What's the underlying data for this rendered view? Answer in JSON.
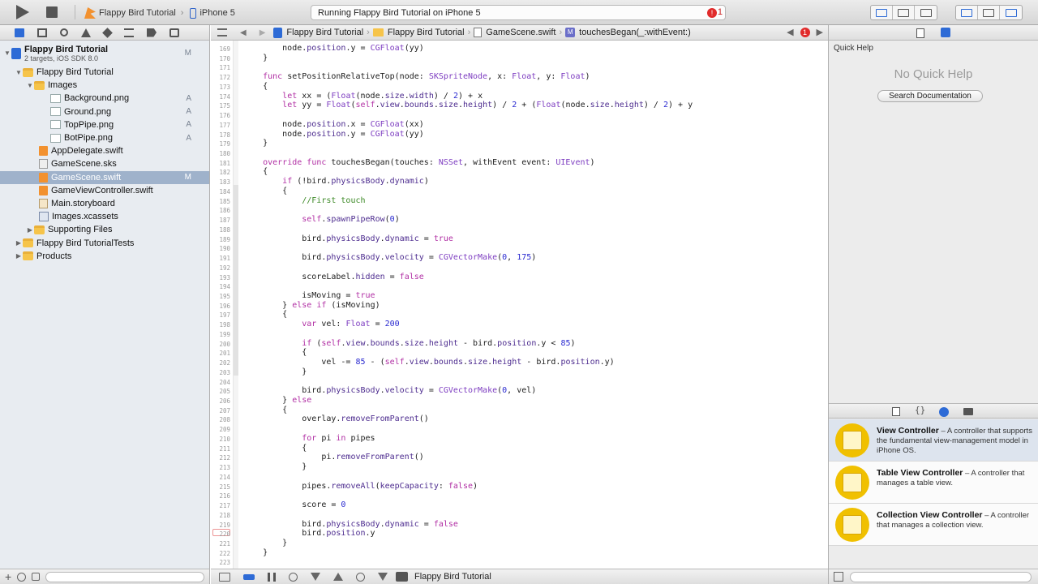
{
  "toolbar": {
    "scheme_target": "Flappy Bird Tutorial",
    "scheme_device": "iPhone 5",
    "status_text": "Running Flappy Bird Tutorial on iPhone 5",
    "error_count": "1",
    "scheme_separator": "›"
  },
  "navigator": {
    "project": {
      "name": "Flappy Bird Tutorial",
      "subtitle": "2 targets, iOS SDK 8.0",
      "badge": "M"
    },
    "items": [
      {
        "label": "Flappy Bird Tutorial",
        "badge": ""
      },
      {
        "label": "Images",
        "badge": ""
      },
      {
        "label": "Background.png",
        "badge": "A"
      },
      {
        "label": "Ground.png",
        "badge": "A"
      },
      {
        "label": "TopPipe.png",
        "badge": "A"
      },
      {
        "label": "BotPipe.png",
        "badge": "A"
      },
      {
        "label": "AppDelegate.swift",
        "badge": ""
      },
      {
        "label": "GameScene.sks",
        "badge": ""
      },
      {
        "label": "GameScene.swift",
        "badge": "M"
      },
      {
        "label": "GameViewController.swift",
        "badge": ""
      },
      {
        "label": "Main.storyboard",
        "badge": ""
      },
      {
        "label": "Images.xcassets",
        "badge": ""
      },
      {
        "label": "Supporting Files",
        "badge": ""
      },
      {
        "label": "Flappy Bird TutorialTests",
        "badge": ""
      },
      {
        "label": "Products",
        "badge": ""
      }
    ]
  },
  "jumpbar": {
    "project": "Flappy Bird Tutorial",
    "group": "Flappy Bird Tutorial",
    "file": "GameScene.swift",
    "method": "touchesBegan(_:withEvent:)",
    "method_badge": "M",
    "separator": "›",
    "error_count": "1"
  },
  "editor": {
    "line_numbers": [
      "169",
      "170",
      "171",
      "172",
      "173",
      "174",
      "175",
      "176",
      "177",
      "178",
      "179",
      "180",
      "181",
      "182",
      "183",
      "184",
      "185",
      "186",
      "187",
      "188",
      "189",
      "190",
      "191",
      "192",
      "193",
      "194",
      "195",
      "196",
      "197",
      "198",
      "199",
      "200",
      "201",
      "202",
      "203",
      "204",
      "205",
      "206",
      "207",
      "208",
      "209",
      "210",
      "211",
      "212",
      "213",
      "214",
      "215",
      "216",
      "217",
      "218",
      "219",
      "220",
      "221",
      "222",
      "223"
    ],
    "lines": [
      "        node.position.y = CGFloat(yy)",
      "    }",
      "    ",
      "    func setPositionRelativeTop(node: SKSpriteNode, x: Float, y: Float)",
      "    {",
      "        let xx = (Float(node.size.width) / 2) + x",
      "        let yy = Float(self.view.bounds.size.height) / 2 + (Float(node.size.height) / 2) + y",
      "        ",
      "        node.position.x = CGFloat(xx)",
      "        node.position.y = CGFloat(yy)",
      "    }",
      "    ",
      "    override func touchesBegan(touches: NSSet, withEvent event: UIEvent)",
      "    {",
      "        if (!bird.physicsBody.dynamic)",
      "        {",
      "            //First touch",
      "            ",
      "            self.spawnPipeRow(0)",
      "            ",
      "            bird.physicsBody.dynamic = true",
      "            ",
      "            bird.physicsBody.velocity = CGVectorMake(0, 175)",
      "            ",
      "            scoreLabel.hidden = false",
      "            ",
      "            isMoving = true",
      "        } else if (isMoving)",
      "        {",
      "            var vel: Float = 200",
      "            ",
      "            if (self.view.bounds.size.height - bird.position.y < 85)",
      "            {",
      "                vel -= 85 - (self.view.bounds.size.height - bird.position.y)",
      "            }",
      "            ",
      "            bird.physicsBody.velocity = CGVectorMake(0, vel)",
      "        } else",
      "        {",
      "            overlay.removeFromParent()",
      "            ",
      "            for pi in pipes",
      "            {",
      "                pi.removeFromParent()",
      "            }",
      "            ",
      "            pipes.removeAll(keepCapacity: false)",
      "            ",
      "            score = 0",
      "            ",
      "            bird.physicsBody.dynamic = false",
      "            bird.position.y",
      "        }",
      "    }",
      "    "
    ]
  },
  "utilities": {
    "quick_help_title": "Quick Help",
    "no_quick_help": "No Quick Help",
    "search_documentation": "Search Documentation",
    "library_items": [
      {
        "title": "View Controller",
        "description": " – A controller that supports the fundamental view-management model in iPhone OS."
      },
      {
        "title": "Table View Controller",
        "description": " – A controller that manages a table view."
      },
      {
        "title": "Collection View Controller",
        "description": " – A controller that manages a collection view."
      }
    ]
  },
  "debugbar": {
    "target": "Flappy Bird Tutorial"
  },
  "colors": {
    "keyword": "#b12fa4",
    "type": "#7e3ec1",
    "comment": "#3d8a27",
    "number": "#2a2ad0",
    "selection": "#9fb2cb",
    "accent": "#2e6bd6",
    "library_icon": "#f0c000"
  }
}
